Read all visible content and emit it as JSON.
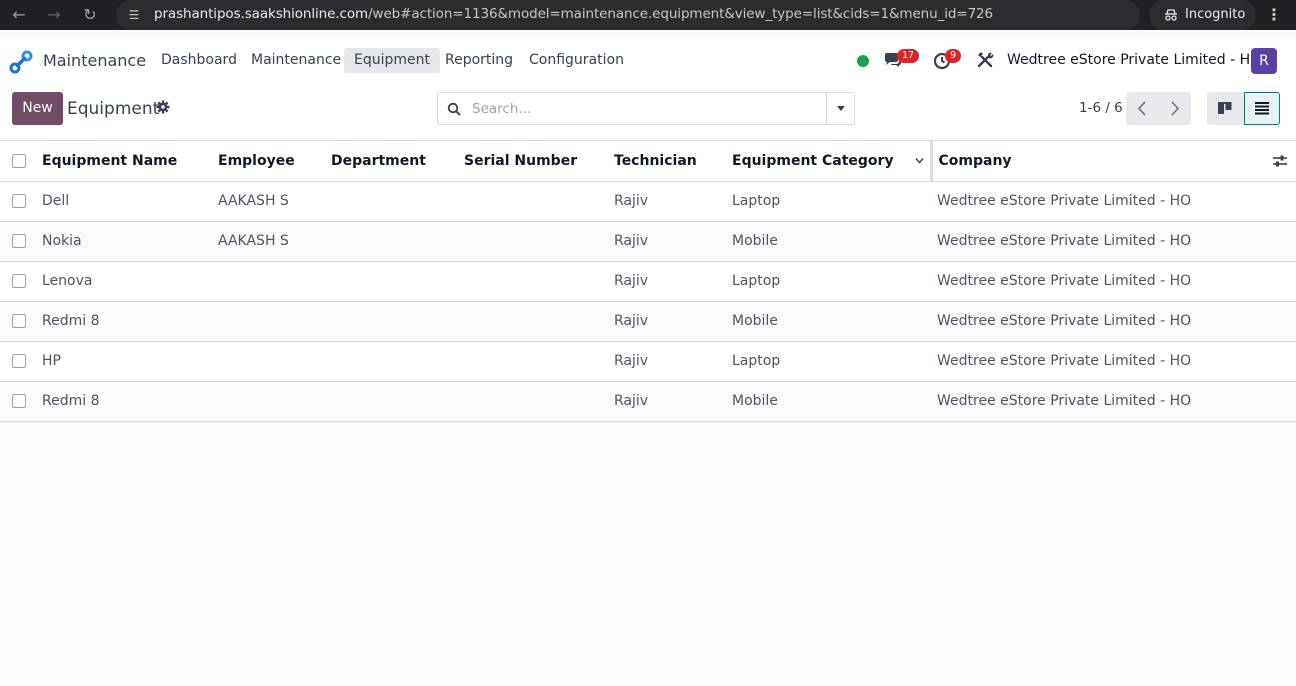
{
  "browser": {
    "url_host": "prashantipos.saakshionline.com",
    "url_path": "/web#action=1136&model=maintenance.equipment&view_type=list&cids=1&menu_id=726",
    "profile_label": "Incognito"
  },
  "navbar": {
    "app_name": "Maintenance",
    "menu": [
      "Dashboard",
      "Maintenance",
      "Equipment",
      "Reporting",
      "Configuration"
    ],
    "active_menu": "Equipment",
    "messages_count": "17",
    "activities_count": "9",
    "company": "Wedtree eStore Private Limited - HO",
    "avatar_letter": "R"
  },
  "control": {
    "new_label": "New",
    "title": "Equipment",
    "search_placeholder": "Search...",
    "pager": "1-6 / 6"
  },
  "table": {
    "columns": [
      "Equipment Name",
      "Employee",
      "Department",
      "Serial Number",
      "Technician",
      "Equipment Category",
      "Company"
    ],
    "sorted_column": "Equipment Category",
    "rows": [
      [
        "Dell",
        "AAKASH S",
        "",
        "",
        "Rajiv",
        "Laptop",
        "Wedtree eStore Private Limited - HO"
      ],
      [
        "Nokia",
        "AAKASH S",
        "",
        "",
        "Rajiv",
        "Mobile",
        "Wedtree eStore Private Limited - HO"
      ],
      [
        "Lenova",
        "",
        "",
        "",
        "Rajiv",
        "Laptop",
        "Wedtree eStore Private Limited - HO"
      ],
      [
        "Redmi 8",
        "",
        "",
        "",
        "Rajiv",
        "Mobile",
        "Wedtree eStore Private Limited - HO"
      ],
      [
        "HP",
        "",
        "",
        "",
        "Rajiv",
        "Laptop",
        "Wedtree eStore Private Limited - HO"
      ],
      [
        "Redmi 8",
        "",
        "",
        "",
        "Rajiv",
        "Mobile",
        "Wedtree eStore Private Limited - HO"
      ]
    ]
  },
  "colors": {
    "primary": "#714b67",
    "accent": "#017e84",
    "badge": "#dc2626",
    "online": "#16a34a"
  }
}
